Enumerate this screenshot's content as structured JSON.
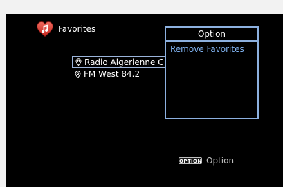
{
  "header": {
    "title": "Favorites",
    "icon": "heart-music-icon"
  },
  "favorites": {
    "items": [
      {
        "label": "Radio Algerienne C",
        "icon": "location-pin-icon",
        "selected": true
      },
      {
        "label": "FM West 84.2",
        "icon": "location-pin-icon",
        "selected": false
      }
    ]
  },
  "option_panel": {
    "title": "Option",
    "items": [
      {
        "label": "Remove Favorites"
      }
    ]
  },
  "footer": {
    "key_label": "OPTION",
    "label": "Option"
  },
  "colors": {
    "background": "#000000",
    "panel_border": "#8cb0df",
    "highlight_text": "#7fb2f0",
    "heart_red": "#d83b2f"
  }
}
